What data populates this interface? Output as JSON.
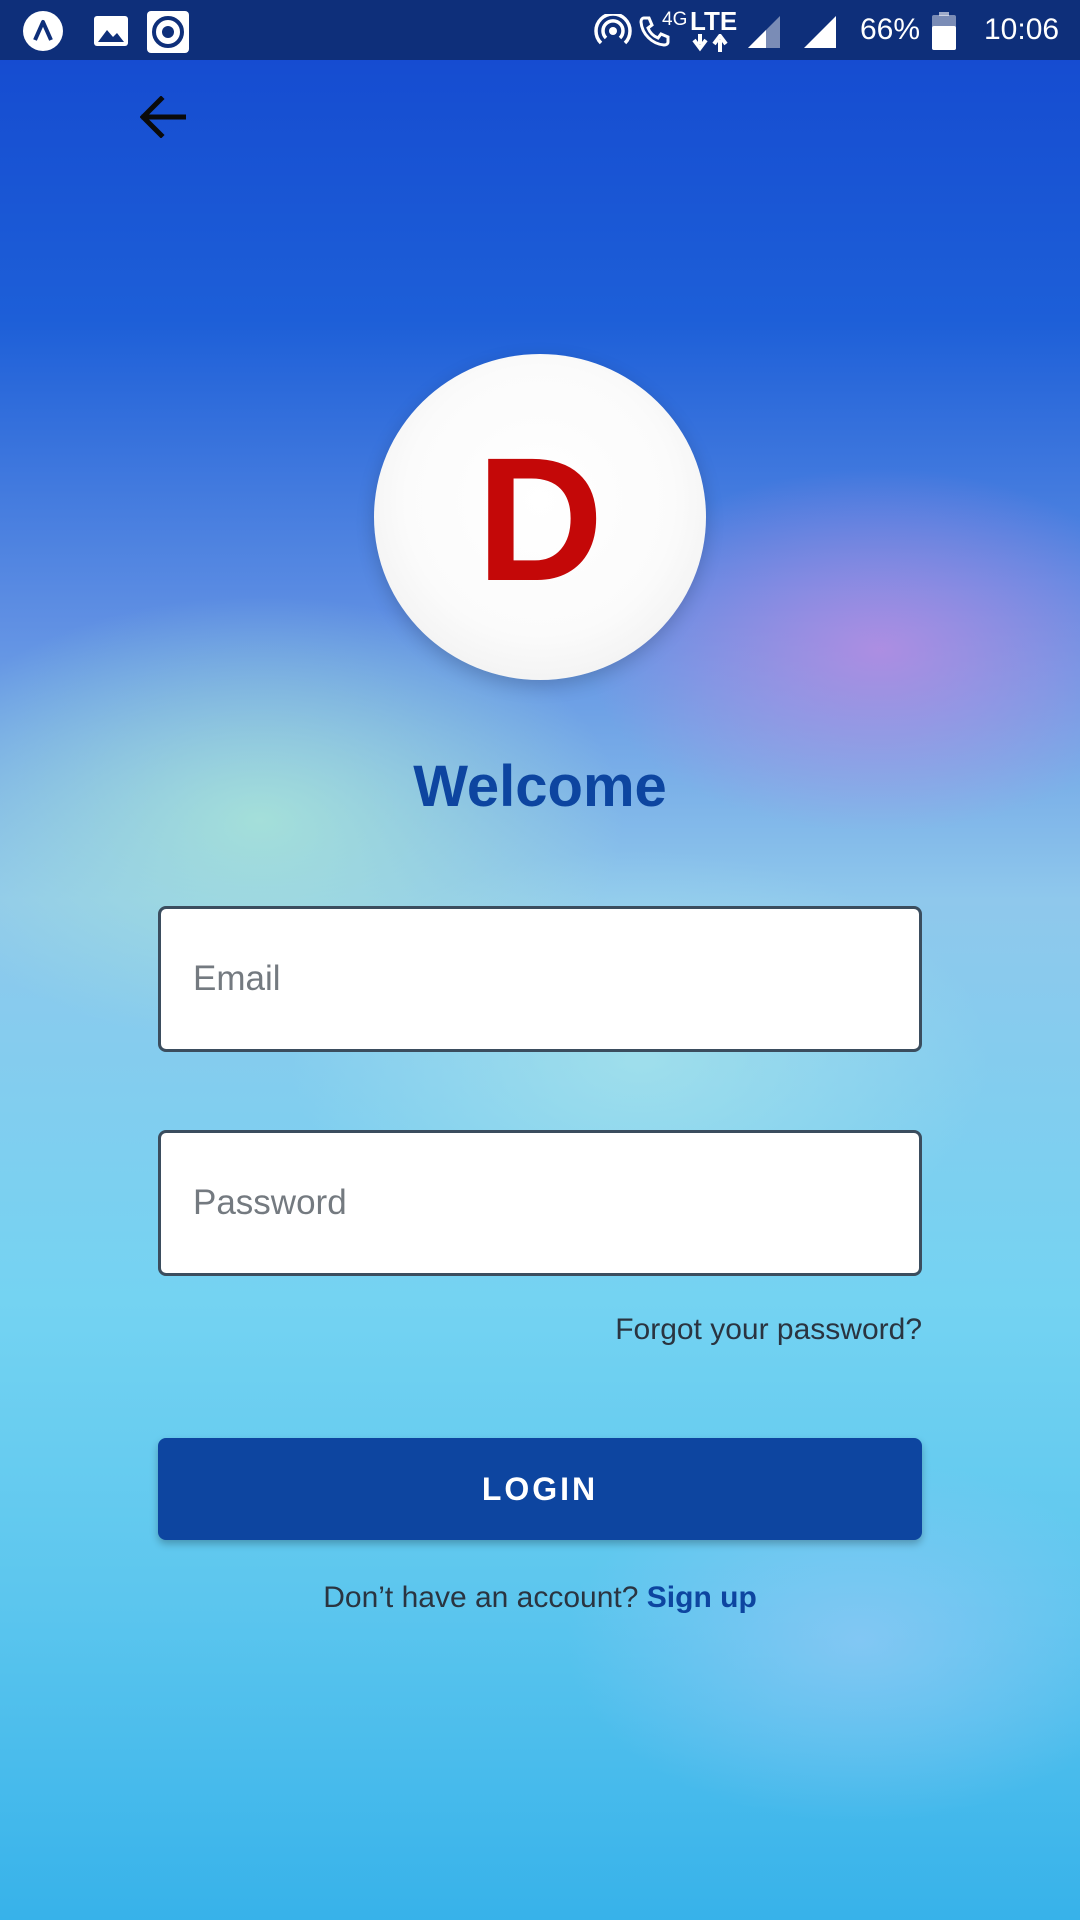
{
  "status_bar": {
    "left_icons": [
      "app-notification-icon",
      "image-notification-icon",
      "screen-record-notification-icon"
    ],
    "right_icons": [
      "hotspot-icon",
      "wifi-call-icon",
      "lte-data-icon",
      "signal-icon",
      "signal-icon",
      "battery-icon"
    ],
    "network_label": "4G",
    "data_label": "LTE",
    "battery_percent": "66%",
    "time": "10:06"
  },
  "header": {
    "back_icon": "arrow-left-icon"
  },
  "logo": {
    "letter": "D",
    "letter_color": "#c40808"
  },
  "welcome_title": "Welcome",
  "form": {
    "email": {
      "placeholder": "Email",
      "value": ""
    },
    "password": {
      "placeholder": "Password",
      "value": ""
    },
    "forgot_password": "Forgot your password?",
    "login_label": "LOGIN"
  },
  "footer": {
    "signup_prompt": "Don’t have an account?",
    "signup_link": "Sign up"
  },
  "colors": {
    "status_bar": "#0e2f7a",
    "primary": "#0d45a0",
    "logo_letter": "#c40808",
    "text": "#2a3440"
  }
}
